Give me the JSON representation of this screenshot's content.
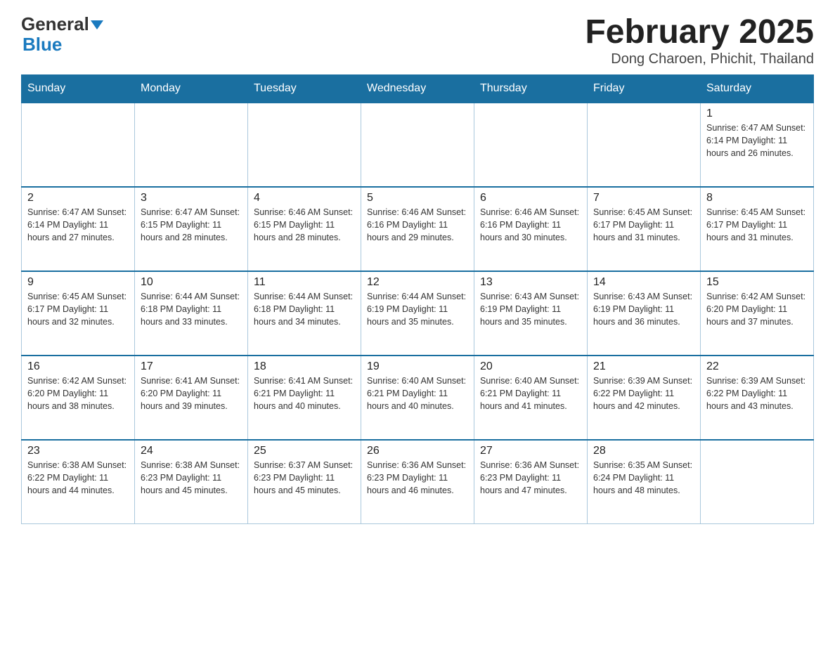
{
  "logo": {
    "line1": "General",
    "line2": "Blue"
  },
  "title": "February 2025",
  "subtitle": "Dong Charoen, Phichit, Thailand",
  "weekdays": [
    "Sunday",
    "Monday",
    "Tuesday",
    "Wednesday",
    "Thursday",
    "Friday",
    "Saturday"
  ],
  "weeks": [
    [
      {
        "day": "",
        "info": ""
      },
      {
        "day": "",
        "info": ""
      },
      {
        "day": "",
        "info": ""
      },
      {
        "day": "",
        "info": ""
      },
      {
        "day": "",
        "info": ""
      },
      {
        "day": "",
        "info": ""
      },
      {
        "day": "1",
        "info": "Sunrise: 6:47 AM\nSunset: 6:14 PM\nDaylight: 11 hours\nand 26 minutes."
      }
    ],
    [
      {
        "day": "2",
        "info": "Sunrise: 6:47 AM\nSunset: 6:14 PM\nDaylight: 11 hours\nand 27 minutes."
      },
      {
        "day": "3",
        "info": "Sunrise: 6:47 AM\nSunset: 6:15 PM\nDaylight: 11 hours\nand 28 minutes."
      },
      {
        "day": "4",
        "info": "Sunrise: 6:46 AM\nSunset: 6:15 PM\nDaylight: 11 hours\nand 28 minutes."
      },
      {
        "day": "5",
        "info": "Sunrise: 6:46 AM\nSunset: 6:16 PM\nDaylight: 11 hours\nand 29 minutes."
      },
      {
        "day": "6",
        "info": "Sunrise: 6:46 AM\nSunset: 6:16 PM\nDaylight: 11 hours\nand 30 minutes."
      },
      {
        "day": "7",
        "info": "Sunrise: 6:45 AM\nSunset: 6:17 PM\nDaylight: 11 hours\nand 31 minutes."
      },
      {
        "day": "8",
        "info": "Sunrise: 6:45 AM\nSunset: 6:17 PM\nDaylight: 11 hours\nand 31 minutes."
      }
    ],
    [
      {
        "day": "9",
        "info": "Sunrise: 6:45 AM\nSunset: 6:17 PM\nDaylight: 11 hours\nand 32 minutes."
      },
      {
        "day": "10",
        "info": "Sunrise: 6:44 AM\nSunset: 6:18 PM\nDaylight: 11 hours\nand 33 minutes."
      },
      {
        "day": "11",
        "info": "Sunrise: 6:44 AM\nSunset: 6:18 PM\nDaylight: 11 hours\nand 34 minutes."
      },
      {
        "day": "12",
        "info": "Sunrise: 6:44 AM\nSunset: 6:19 PM\nDaylight: 11 hours\nand 35 minutes."
      },
      {
        "day": "13",
        "info": "Sunrise: 6:43 AM\nSunset: 6:19 PM\nDaylight: 11 hours\nand 35 minutes."
      },
      {
        "day": "14",
        "info": "Sunrise: 6:43 AM\nSunset: 6:19 PM\nDaylight: 11 hours\nand 36 minutes."
      },
      {
        "day": "15",
        "info": "Sunrise: 6:42 AM\nSunset: 6:20 PM\nDaylight: 11 hours\nand 37 minutes."
      }
    ],
    [
      {
        "day": "16",
        "info": "Sunrise: 6:42 AM\nSunset: 6:20 PM\nDaylight: 11 hours\nand 38 minutes."
      },
      {
        "day": "17",
        "info": "Sunrise: 6:41 AM\nSunset: 6:20 PM\nDaylight: 11 hours\nand 39 minutes."
      },
      {
        "day": "18",
        "info": "Sunrise: 6:41 AM\nSunset: 6:21 PM\nDaylight: 11 hours\nand 40 minutes."
      },
      {
        "day": "19",
        "info": "Sunrise: 6:40 AM\nSunset: 6:21 PM\nDaylight: 11 hours\nand 40 minutes."
      },
      {
        "day": "20",
        "info": "Sunrise: 6:40 AM\nSunset: 6:21 PM\nDaylight: 11 hours\nand 41 minutes."
      },
      {
        "day": "21",
        "info": "Sunrise: 6:39 AM\nSunset: 6:22 PM\nDaylight: 11 hours\nand 42 minutes."
      },
      {
        "day": "22",
        "info": "Sunrise: 6:39 AM\nSunset: 6:22 PM\nDaylight: 11 hours\nand 43 minutes."
      }
    ],
    [
      {
        "day": "23",
        "info": "Sunrise: 6:38 AM\nSunset: 6:22 PM\nDaylight: 11 hours\nand 44 minutes."
      },
      {
        "day": "24",
        "info": "Sunrise: 6:38 AM\nSunset: 6:23 PM\nDaylight: 11 hours\nand 45 minutes."
      },
      {
        "day": "25",
        "info": "Sunrise: 6:37 AM\nSunset: 6:23 PM\nDaylight: 11 hours\nand 45 minutes."
      },
      {
        "day": "26",
        "info": "Sunrise: 6:36 AM\nSunset: 6:23 PM\nDaylight: 11 hours\nand 46 minutes."
      },
      {
        "day": "27",
        "info": "Sunrise: 6:36 AM\nSunset: 6:23 PM\nDaylight: 11 hours\nand 47 minutes."
      },
      {
        "day": "28",
        "info": "Sunrise: 6:35 AM\nSunset: 6:24 PM\nDaylight: 11 hours\nand 48 minutes."
      },
      {
        "day": "",
        "info": ""
      }
    ]
  ]
}
